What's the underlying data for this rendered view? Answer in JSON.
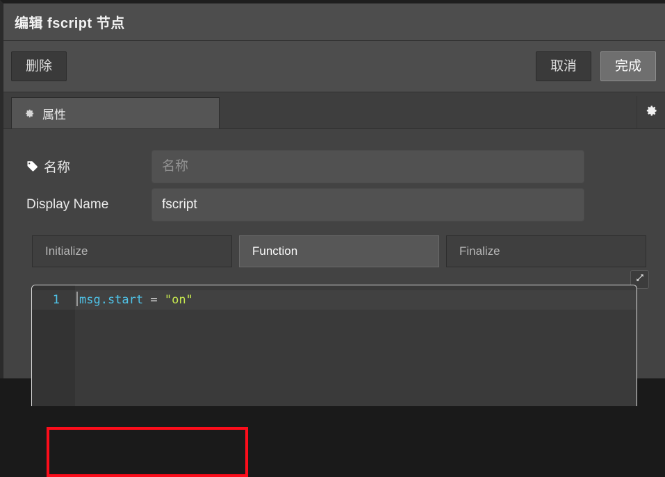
{
  "dialog": {
    "title": "编辑 fscript 节点"
  },
  "toolbar": {
    "delete_label": "删除",
    "cancel_label": "取消",
    "done_label": "完成"
  },
  "tabstrip": {
    "properties_tab_label": "属性",
    "properties_tab_icon": "gear-icon",
    "settings_icon": "gear-icon"
  },
  "form": {
    "name": {
      "label": "名称",
      "icon": "tag-icon",
      "value": "",
      "placeholder": "名称"
    },
    "display_name": {
      "label": "Display Name",
      "value": "fscript",
      "placeholder": ""
    }
  },
  "code_tabs": [
    {
      "label": "Initialize",
      "active": false
    },
    {
      "label": "Function",
      "active": true
    },
    {
      "label": "Finalize",
      "active": false
    }
  ],
  "editor": {
    "expand_icon": "expand-arrows-icon",
    "lines": [
      {
        "number": "1",
        "tokens": [
          {
            "text": "msg.start",
            "type": "prop"
          },
          {
            "text": " = ",
            "type": "op"
          },
          {
            "text": "\"on\"",
            "type": "str"
          }
        ]
      }
    ]
  },
  "annotation": {
    "color": "#fc0d1b",
    "shape": "rectangle"
  },
  "colors": {
    "dialog_bg": "#434343",
    "header_bg": "#4d4d4d",
    "accent_primary": "#6f6f6f",
    "editor_bg": "#3a3a3a",
    "token_property": "#4fc3e8",
    "token_string": "#c6e84f",
    "annotation_red": "#fc0d1b"
  }
}
